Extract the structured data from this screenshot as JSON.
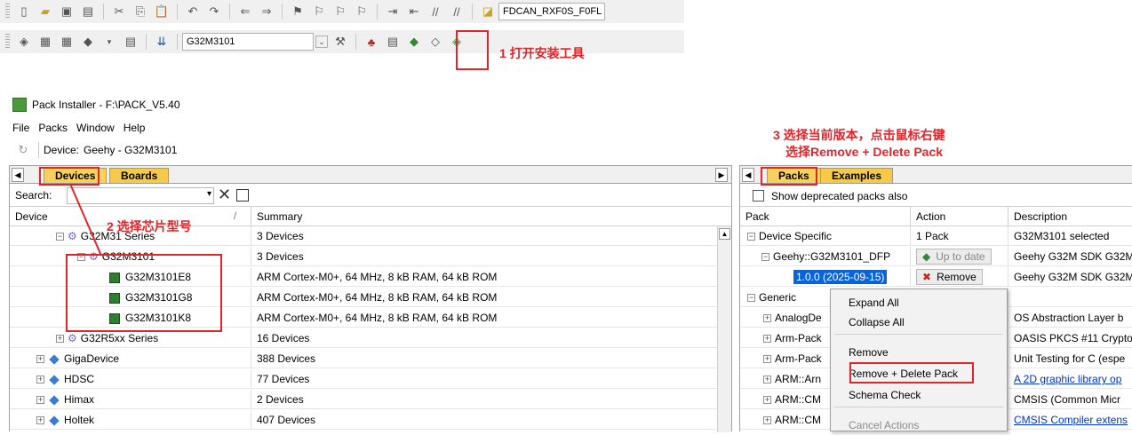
{
  "toolbar1": {
    "target_label": "FDCAN_RXF0S_F0FL"
  },
  "toolbar2": {
    "target_select": "G32M3101"
  },
  "annotations": {
    "step1": "1 打开安装工具",
    "step2": "2 选择芯片型号",
    "step3_line1": "3 选择当前版本，点击鼠标右键",
    "step3_line2": "选择Remove + Delete Pack"
  },
  "window": {
    "title": "Pack Installer - F:\\PACK_V5.40"
  },
  "menu": [
    "File",
    "Packs",
    "Window",
    "Help"
  ],
  "device_bar": {
    "label": "Device:",
    "value": "Geehy - G32M3101"
  },
  "left": {
    "tabs": [
      "Devices",
      "Boards"
    ],
    "search_label": "Search:",
    "col_device": "Device",
    "col_summary": "Summary",
    "rows": [
      {
        "name": "G32M31 Series",
        "summary": "3 Devices"
      },
      {
        "name": "G32M3101",
        "summary": "3 Devices"
      },
      {
        "name": "G32M3101E8",
        "summary": "ARM Cortex-M0+, 64 MHz, 8 kB RAM, 64 kB ROM"
      },
      {
        "name": "G32M3101G8",
        "summary": "ARM Cortex-M0+, 64 MHz, 8 kB RAM, 64 kB ROM"
      },
      {
        "name": "G32M3101K8",
        "summary": "ARM Cortex-M0+, 64 MHz, 8 kB RAM, 64 kB ROM"
      },
      {
        "name": "G32R5xx Series",
        "summary": "16 Devices"
      },
      {
        "name": "GigaDevice",
        "summary": "388 Devices"
      },
      {
        "name": "HDSC",
        "summary": "77 Devices"
      },
      {
        "name": "Himax",
        "summary": "2 Devices"
      },
      {
        "name": "Holtek",
        "summary": "407 Devices"
      }
    ]
  },
  "right": {
    "tabs": [
      "Packs",
      "Examples"
    ],
    "checkbox_label": "Show deprecated packs also",
    "col_pack": "Pack",
    "col_action": "Action",
    "col_desc": "Description",
    "rows": [
      {
        "pack": "Device Specific",
        "action": "1 Pack",
        "desc": "G32M3101 selected"
      },
      {
        "pack": "Geehy::G32M3101_DFP",
        "action": "Up to date",
        "desc": "Geehy G32M SDK G32M"
      },
      {
        "pack": "1.0.0 (2025-09-15)",
        "action": "Remove",
        "desc": "Geehy G32M SDK G32M"
      },
      {
        "pack": "Generic",
        "action": "",
        "desc": ""
      },
      {
        "pack": "AnalogDe",
        "action": "",
        "desc": "OS Abstraction Layer b"
      },
      {
        "pack": "Arm-Pack",
        "action": "",
        "desc": "OASIS PKCS #11 Crypto"
      },
      {
        "pack": "Arm-Pack",
        "action": "",
        "desc": "Unit Testing for C (espe"
      },
      {
        "pack": "ARM::Arn",
        "action": "",
        "desc": "A 2D graphic library op"
      },
      {
        "pack": "ARM::CM",
        "action": "",
        "desc": "CMSIS (Common Micr"
      },
      {
        "pack": "ARM::CM",
        "action": "",
        "desc": "CMSIS Compiler extens"
      }
    ]
  },
  "context_menu": [
    "Expand All",
    "Collapse All",
    "Remove",
    "Remove + Delete Pack",
    "Schema Check",
    "Cancel Actions"
  ]
}
